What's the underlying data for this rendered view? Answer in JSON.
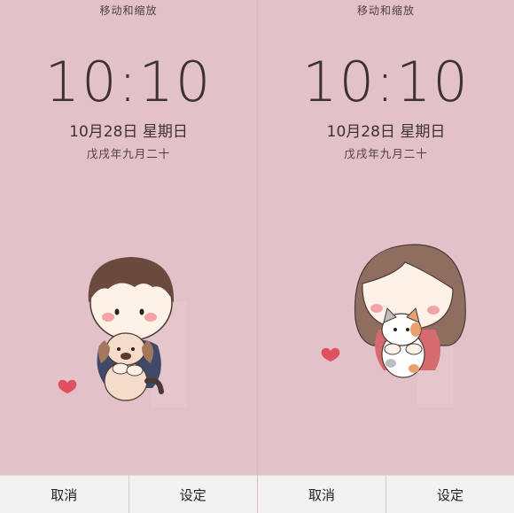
{
  "screens": [
    {
      "hint": "移动和缩放",
      "time": "10:10",
      "date": "10月28日 星期日",
      "lunar": "戊戌年九月二十",
      "artwork": "boy-holding-puppy",
      "buttons": {
        "cancel": "取消",
        "set": "设定"
      }
    },
    {
      "hint": "移动和缩放",
      "time": "10:10",
      "date": "10月28日 星期日",
      "lunar": "戊戌年九月二十",
      "artwork": "girl-holding-cat",
      "buttons": {
        "cancel": "取消",
        "set": "设定"
      }
    }
  ],
  "colors": {
    "background": "#e3c1c8",
    "text": "#3d3233",
    "bar": "#f3f2f2",
    "heart": "#e0505f"
  },
  "icons": [
    "heart-icon",
    "boy-illustration",
    "puppy-illustration",
    "girl-illustration",
    "cat-illustration"
  ]
}
